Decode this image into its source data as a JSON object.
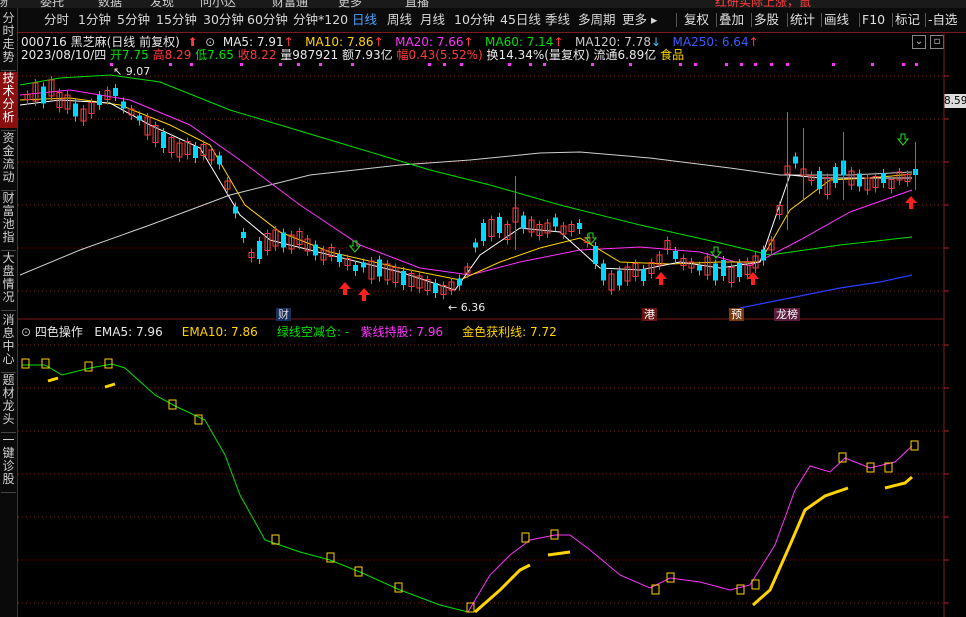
{
  "menubar": [
    "场",
    "委托",
    "数据",
    "发现",
    "问小达",
    "财富通",
    "更多",
    "直播"
  ],
  "menubar_alert": "红研实际上涨，鼠",
  "toolbar": {
    "periods": [
      "分时",
      "1分钟",
      "5分钟",
      "15分钟",
      "30分钟",
      "60分钟",
      "分钟*120",
      "日线",
      "周线",
      "月线",
      "10分钟",
      "45日线",
      "季线",
      "多周期",
      "更多 ▸"
    ],
    "active": "日线",
    "actions": [
      "复权",
      "叠加",
      "多股",
      "统计",
      "画线",
      "F10",
      "标记",
      "-自选"
    ]
  },
  "leftnav": [
    {
      "label": "分时走势",
      "active": false
    },
    {
      "label": "技术分析",
      "active": true
    },
    {
      "label": "资金流动",
      "active": false
    },
    {
      "label": "财富池指",
      "active": false
    },
    {
      "label": "大盘情况",
      "active": false
    },
    {
      "label": "消息中心",
      "active": false
    },
    {
      "label": "题材龙头",
      "active": false
    },
    {
      "label": "一键诊股",
      "active": false
    }
  ],
  "header": {
    "code_name": "000716 黑芝麻(日线 前复权)",
    "ma5": "MA5: 7.91",
    "ma10": "MA10: 7.86",
    "ma20": "MA20: 7.66",
    "ma60": "MA60: 7.14",
    "ma120": "MA120: 7.78",
    "ma250": "MA250: 6.64",
    "date": "2023/08/10/四",
    "open": "开7.75",
    "high": "高8.29",
    "low": "低7.65",
    "close": "收8.22",
    "volume": "量987921",
    "amount": "额7.93亿",
    "change": "幅0.43(5.52%)",
    "turnover": "换14.34%(量复权)",
    "float_cap": "流通6.89亿",
    "sector": "食品"
  },
  "price_tag": "8.59",
  "annotations": {
    "high": "9.07",
    "low": "6.36",
    "flag_cai": "财",
    "flag_gang": "港",
    "flag_yu": "预",
    "flag_long": "龙榜"
  },
  "indicator": {
    "name": "四色操作",
    "ema5": "EMA5: 7.96",
    "ema10": "EMA10: 7.86",
    "green_line": "绿线空减仓: -",
    "purple_line": "紫线持股: 7.96",
    "gold_line": "金色获利线: 7.72"
  },
  "colors": {
    "up": "#ff3b3b",
    "down": "#00d8ff",
    "ma5": "#ffffff",
    "ma10": "#ffd400",
    "ma20": "#ff33ff",
    "ma60": "#00e000",
    "ma120": "#cfcfcf",
    "ma250": "#2a3cff",
    "grid": "#7a1a1a"
  }
}
